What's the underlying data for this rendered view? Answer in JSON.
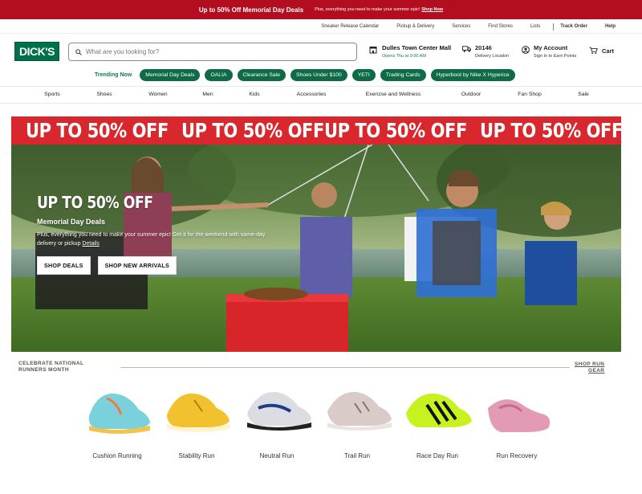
{
  "promo": {
    "title": "Up to 50% Off Memorial Day Deals",
    "subtitle": "Plus, everything you need to make your summer epic!",
    "link": "Shop Now"
  },
  "utility_links": {
    "sneaker_calendar": "Sneaker Release Calendar",
    "pickup": "Pickup & Delivery",
    "services": "Services",
    "find_stores": "Find Stores",
    "lists": "Lists",
    "track_order": "Track Order",
    "help": "Help"
  },
  "header": {
    "logo": "DICK'S",
    "search_placeholder": "What are you looking for?",
    "store_name": "Dulles Town Center Mall",
    "store_hours": "Opens Thu at 9:00 AM",
    "zip": "20146",
    "zip_label": "Delivery Location",
    "account_title": "My Account",
    "account_sub": "Sign In to Earn Points",
    "cart": "Cart"
  },
  "trending": {
    "label": "Trending Now",
    "chips": [
      "Memorial Day Deals",
      "OALIA",
      "Clearance Sale",
      "Shoes Under $100",
      "YETI",
      "Trading Cards",
      "Hyperboot by Nike X Hyperice"
    ]
  },
  "categories": [
    "Sports",
    "Shoes",
    "Women",
    "Men",
    "Kids",
    "Accessories",
    "Exercise and Wellness",
    "Outdoor",
    "Fan Shop",
    "Sale"
  ],
  "hero": {
    "banner_text": "UP TO 50% OFF",
    "headline": "UP TO 50% OFF",
    "subhead": "Memorial Day Deals",
    "description": "Plus, everything you need to make your summer epic! Get it for the weekend with same-day delivery or pickup",
    "details_link": "Details",
    "shop_deals": "SHOP DEALS",
    "shop_new": "SHOP NEW ARRIVALS"
  },
  "runners": {
    "heading": "CELEBRATE NATIONAL RUNNERS MONTH",
    "heading_line1": "CELEBRATE NATIONAL",
    "heading_line2": "RUNNERS MONTH",
    "shop_link_line1": "SHOP RUN",
    "shop_link_line2": "GEAR",
    "items": [
      "Cushion Running",
      "Stability Run",
      "Neutral Run",
      "Trail Run",
      "Race Day Run",
      "Run Recovery"
    ]
  },
  "colors": {
    "brand_green": "#0f6b47",
    "promo_red": "#b30e1f",
    "banner_red": "#d8282d"
  }
}
